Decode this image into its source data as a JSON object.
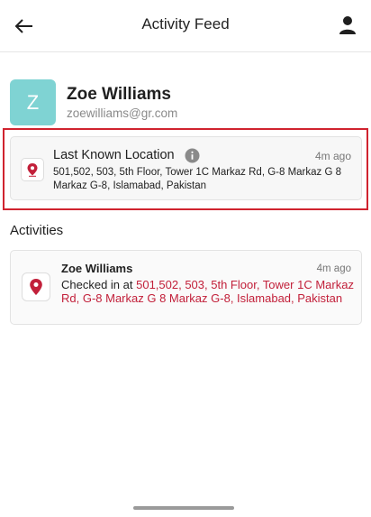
{
  "header": {
    "title": "Activity Feed",
    "back_icon": "arrow-left-icon",
    "profile_icon": "person-icon"
  },
  "user": {
    "avatar_letter": "Z",
    "avatar_color": "#7fd3d3",
    "name": "Zoe Williams",
    "email": "zoewilliams@gr.com"
  },
  "last_location": {
    "title": "Last Known Location",
    "time": "4m ago",
    "address": "501,502, 503, 5th Floor, Tower 1C Markaz Rd, G-8 Markaz G 8 Markaz G-8, Islamabad, Pakistan",
    "icon": "location-pin-icon",
    "info_icon": "info-icon",
    "highlight_color": "#d0232f"
  },
  "activities": {
    "section_title": "Activities",
    "items": [
      {
        "name": "Zoe Williams",
        "time": "4m ago",
        "prefix": "Checked in at ",
        "address": "501,502, 503, 5th Floor, Tower 1C Markaz Rd, G-8 Markaz G 8 Markaz G-8, Islamabad, Pakistan",
        "icon": "location-pin-icon"
      }
    ]
  },
  "colors": {
    "accent": "#c2203a"
  }
}
